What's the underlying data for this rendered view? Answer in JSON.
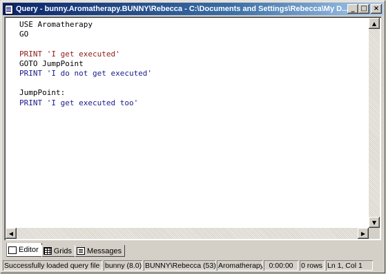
{
  "window": {
    "title": "Query - bunny.Aromatherapy.BUNNY\\Rebecca - C:\\Documents and Settings\\Rebecca\\My D...",
    "controls": {
      "minimize": "_",
      "maximize": "□",
      "close": "×"
    }
  },
  "editor": {
    "lines": [
      {
        "text": "USE Aromatherapy",
        "color": "black"
      },
      {
        "text": "GO",
        "color": "black"
      },
      {
        "text": "",
        "color": "black"
      },
      {
        "text": "PRINT 'I get executed'",
        "color": "red"
      },
      {
        "text": "GOTO JumpPoint",
        "color": "black"
      },
      {
        "text": "PRINT 'I do not get executed'",
        "color": "blue"
      },
      {
        "text": "",
        "color": "black"
      },
      {
        "text": "JumpPoint:",
        "color": "black"
      },
      {
        "text": "PRINT 'I get executed too'",
        "color": "blue"
      }
    ]
  },
  "tabs": [
    {
      "label": "Editor",
      "icon": "editor-icon",
      "active": true
    },
    {
      "label": "Grids",
      "icon": "grid-icon",
      "active": false
    },
    {
      "label": "Messages",
      "icon": "messages-icon",
      "active": false
    }
  ],
  "status": {
    "message": "Successfully loaded query file C:\\",
    "server": "bunny (8.0)",
    "user": "BUNNY\\Rebecca (53)",
    "database": "Aromatherapy",
    "time": "0:00:00",
    "rows": "0 rows",
    "position": "Ln 1, Col 1"
  },
  "colors": {
    "title_start": "#0a246a",
    "title_end": "#a6caf0",
    "code_red": "#8b1a1a",
    "code_blue": "#1a1a8b"
  }
}
